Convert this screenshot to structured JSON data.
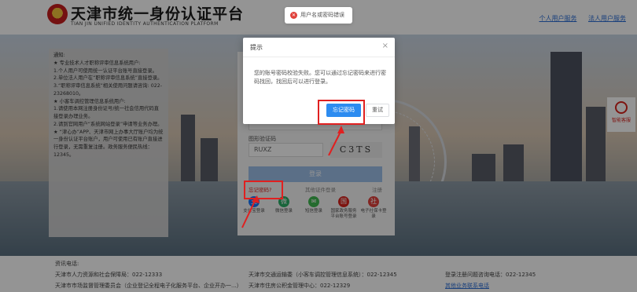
{
  "header": {
    "title": "天津市统一身份认证平台",
    "subtitle": "TIAN JIN UNIFIED IDENTITY AUTHENTICATION PLATFORM",
    "links": [
      "个人用户服务",
      "法人用户服务"
    ]
  },
  "toast": {
    "text": "用户名或密码错误"
  },
  "notice": {
    "lines": [
      "通知:",
      "★ 专业技术人才职称评审信息系统用户:",
      "1.个人用户可使用统一认证平台账号直接登录。",
      "2.单位法人用户在“职称评审信息系统”直接登录。",
      "3.“职称评审信息系统”相关使用问题请咨询: 022-23268010。",
      "★ 小客车调控管理信息系统用户:",
      "1.请使用本网注册身份证号/统一社会信用代码直接登录办理业务。",
      "2.请到官网用户“系统网站登录”申请等业务办理。",
      "★ “津心办”APP、天津市网上办事大厅账户均为统一身份认证平台账户，用户可使用已有账户直接进行登录，无需重复注册。政务服务便民热线：12345。"
    ]
  },
  "login": {
    "password_mask": "••••••••",
    "captcha_label": "图形验证码",
    "captcha_value": "RUXZ",
    "captcha_image_text": "C3TS",
    "login_button": "登录",
    "forgot_link": "忘记密码?",
    "other_login": "其他证件登录",
    "register": "注册",
    "methods": [
      {
        "label": "支付宝登录",
        "color": "#1677ff",
        "glyph": "支"
      },
      {
        "label": "微信登录",
        "color": "#2aae67",
        "glyph": "微"
      },
      {
        "label": "短信登录",
        "color": "#3fb950",
        "glyph": "✉"
      },
      {
        "label": "国家政务服务平台账号登录",
        "color": "#d9231d",
        "glyph": "国"
      },
      {
        "label": "电子社保卡登录",
        "color": "#e0413b",
        "glyph": "社"
      }
    ]
  },
  "dialog": {
    "title": "提示",
    "close": "×",
    "message": "您的账号密码校验失败。您可以通过忘记密码来进行密码找回，找回后可以进行登录。",
    "primary_button": "忘记密码",
    "secondary_button": "重试"
  },
  "help": {
    "label": "智能客服"
  },
  "footer": {
    "consult_title": "资讯电话:",
    "items": [
      "天津市人力资源和社会保障局：022-12333",
      "天津市交通运输委（小客车调控管理信息系统）：022-12345",
      "登录注册问题咨询电话：022-12345",
      "天津市市场监督管理委员会（企业登记全程电子化服务平台、企业开办一...）",
      "天津市住房公积金管理中心：022-12329",
      "其他业务联系电话"
    ]
  },
  "annotation_color": "#e02020"
}
